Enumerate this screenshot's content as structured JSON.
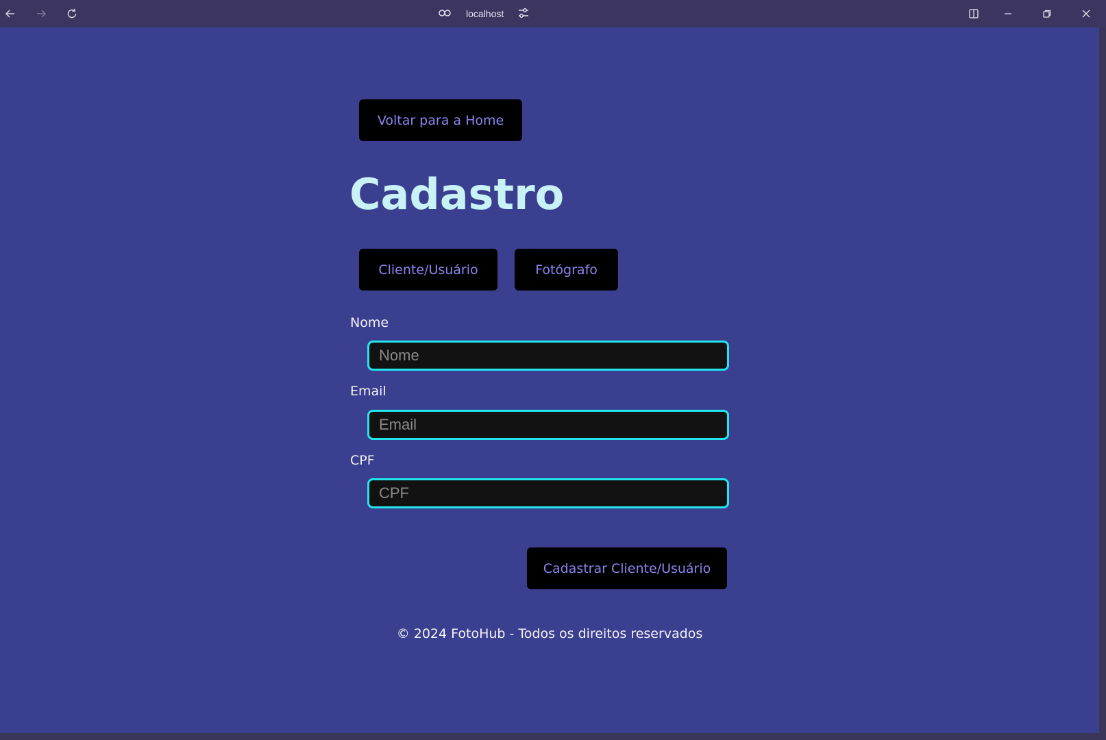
{
  "browser": {
    "url": "localhost",
    "icons": {
      "back": "arrow-left-icon",
      "forward": "arrow-right-icon",
      "reload": "reload-icon",
      "link": "link-icon",
      "site_settings": "sliders-icon",
      "split": "split-view-icon",
      "minimize": "minimize-icon",
      "restore": "restore-icon",
      "close": "close-icon"
    }
  },
  "page": {
    "back_home_label": "Voltar para a Home",
    "title": "Cadastro",
    "tabs": [
      {
        "label": "Cliente/Usuário"
      },
      {
        "label": "Fotógrafo"
      }
    ],
    "fields": [
      {
        "label": "Nome",
        "placeholder": "Nome",
        "value": ""
      },
      {
        "label": "Email",
        "placeholder": "Email",
        "value": ""
      },
      {
        "label": "CPF",
        "placeholder": "CPF",
        "value": ""
      }
    ],
    "submit_label": "Cadastrar Cliente/Usuário",
    "footer": "© 2024 FotoHub - Todos os direitos reservados"
  },
  "colors": {
    "page_background": "#3b3f8f",
    "titlebar": "#3b3560",
    "button_background": "#000000",
    "button_text": "#8a86f0",
    "title_text": "#c8f2f6",
    "input_border": "#22e6ee",
    "input_background": "#121212"
  }
}
